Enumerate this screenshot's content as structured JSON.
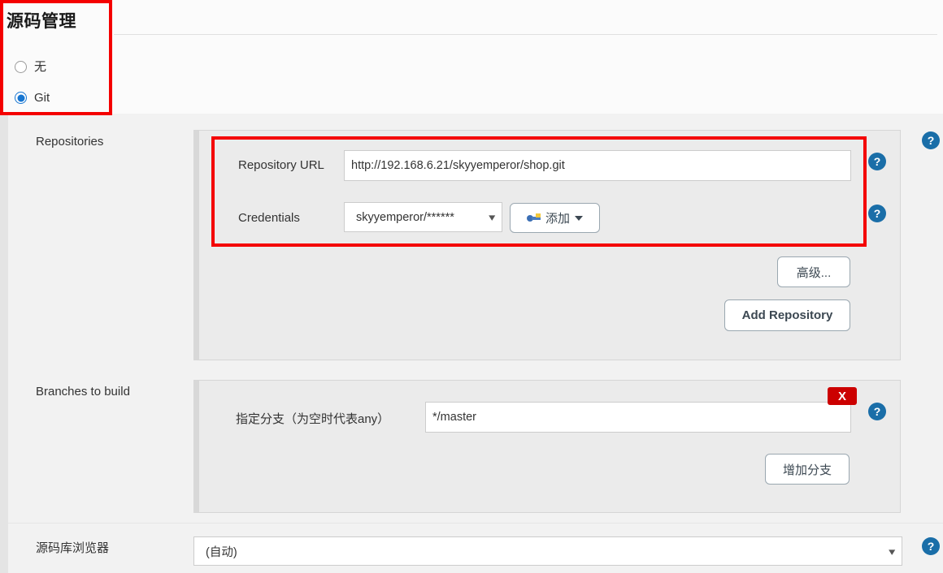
{
  "scm": {
    "title": "源码管理",
    "options": [
      {
        "label": "无",
        "selected": false
      },
      {
        "label": "Git",
        "selected": true
      }
    ]
  },
  "repositories": {
    "row_label": "Repositories",
    "url": {
      "label": "Repository URL",
      "value": "http://192.168.6.21/skyyemperor/shop.git"
    },
    "credentials": {
      "label": "Credentials",
      "selected": "skyyemperor/******",
      "add_button": "添加",
      "add_icon": "key-icon",
      "caret_icon": "caret-down-icon"
    },
    "advanced_button": "高级...",
    "add_repository_button": "Add Repository",
    "help_icon": "?"
  },
  "branches": {
    "row_label": "Branches to build",
    "specifier": {
      "label": "指定分支（为空时代表any）",
      "value": "*/master"
    },
    "delete_button": "X",
    "add_branch_button": "增加分支",
    "help_icon": "?"
  },
  "repository_browser": {
    "row_label": "源码库浏览器",
    "selected": "(自动)",
    "help_icon": "?"
  },
  "colors": {
    "annotation_red": "#f40000",
    "accent_blue": "#1675d1",
    "help_blue": "#1a6ea8",
    "delete_red": "#cc0000",
    "panel_bg": "#ebebeb",
    "page_bg": "#f2f2f2"
  }
}
